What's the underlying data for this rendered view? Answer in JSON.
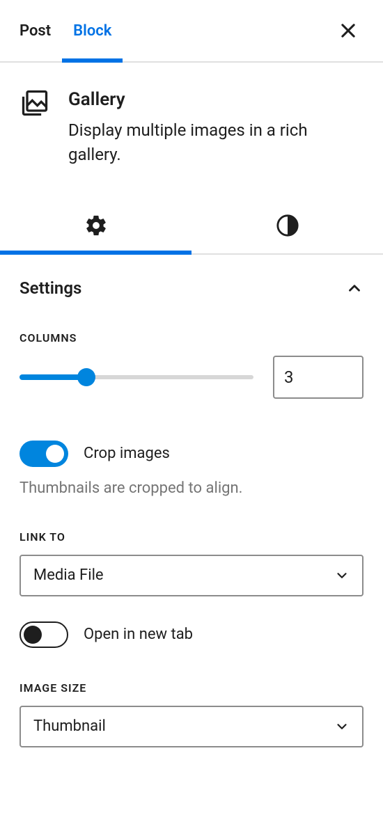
{
  "tabs": {
    "post": "Post",
    "block": "Block"
  },
  "block": {
    "title": "Gallery",
    "description": "Display multiple images in a rich gallery."
  },
  "panel": {
    "section_title": "Settings",
    "columns_label": "Columns",
    "columns_value": "3",
    "columns_min": 1,
    "columns_max": 8,
    "crop_label": "Crop images",
    "crop_help": "Thumbnails are cropped to align.",
    "link_to_label": "Link to",
    "link_to_value": "Media File",
    "open_new_tab_label": "Open in new tab",
    "image_size_label": "Image size",
    "image_size_value": "Thumbnail"
  }
}
